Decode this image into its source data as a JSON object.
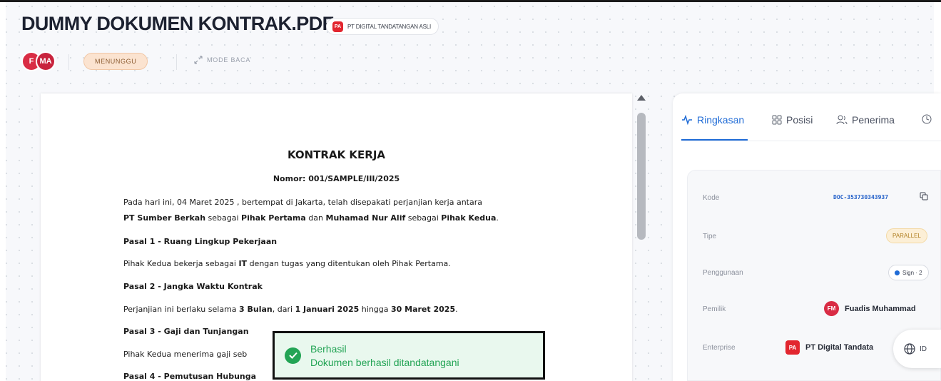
{
  "header": {
    "title": "DUMMY DOKUMEN KONTRAK.PDF",
    "enterprise_chip": {
      "initials": "PA",
      "label": "PT DIGITAL TANDATANGAN ASLI"
    },
    "avatars": [
      "F",
      "MA"
    ],
    "status": "MENUNGGU",
    "read_mode": "MODE BACA"
  },
  "document": {
    "title": "KONTRAK KERJA",
    "number": "Nomor: 001/SAMPLE/III/2025",
    "p1_a": "Pada hari ini, 04 Maret 2025 , bertempat di Jakarta, telah disepakati perjanjian kerja antara",
    "p1_b_1": "PT Sumber Berkah",
    "p1_b_2": " sebagai ",
    "p1_b_3": "Pihak Pertama",
    "p1_b_4": " dan ",
    "p1_b_5": "Muhamad Nur Alif",
    "p1_b_6": " sebagai ",
    "p1_b_7": "Pihak Kedua",
    "p1_b_8": ".",
    "pasal1_h": "Pasal 1 - Ruang Lingkup Pekerjaan",
    "pasal1_a": "Pihak Kedua bekerja sebagai ",
    "pasal1_b": "IT",
    "pasal1_c": " dengan tugas yang ditentukan oleh Pihak Pertama.",
    "pasal2_h": "Pasal 2 - Jangka Waktu Kontrak",
    "pasal2_a": "Perjanjian ini berlaku selama ",
    "pasal2_b": "3 Bulan",
    "pasal2_c": ", dari ",
    "pasal2_d": "1 Januari 2025",
    "pasal2_e": " hingga ",
    "pasal2_f": "30 Maret 2025",
    "pasal2_g": ".",
    "pasal3_h": "Pasal 3 - Gaji dan Tunjangan",
    "pasal3_a": "Pihak Kedua menerima gaji seb",
    "pasal4_h": "Pasal 4 - Pemutusan Hubunga"
  },
  "panel": {
    "tabs": [
      {
        "label": "Ringkasan",
        "icon": "activity-icon",
        "active": true
      },
      {
        "label": "Posisi",
        "icon": "grid-icon",
        "active": false
      },
      {
        "label": "Penerima",
        "icon": "users-icon",
        "active": false
      },
      {
        "label": "",
        "icon": "clock-icon",
        "active": false
      }
    ],
    "labels": {
      "code": "Kode",
      "type": "Tipe",
      "usage": "Penggunaan",
      "owner": "Pemilik",
      "enterprise": "Enterprise"
    },
    "code_value": "DOC-353730343937",
    "type_value": "PARALLEL",
    "usage_value": "Sign · 2",
    "owner": {
      "initials": "FM",
      "name": "Fuadis Muhammad"
    },
    "enterprise": {
      "initials": "PA",
      "name": "PT Digital Tandata"
    },
    "language": "ID"
  },
  "toast": {
    "title": "Berhasil",
    "message": "Dokumen berhasil ditandatangani",
    "accent": "#23a455"
  },
  "colors": {
    "primary": "#1f6bd6",
    "danger": "#e2262f",
    "pending_bg": "#fbe3d0",
    "success": "#23a455"
  }
}
